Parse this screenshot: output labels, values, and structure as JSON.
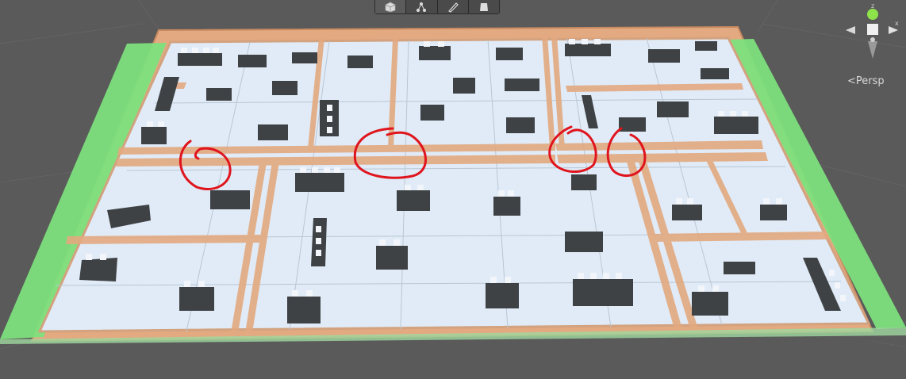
{
  "scene": {
    "projection_label": "Persp",
    "gizmo_axes": {
      "z": "z",
      "x": "x"
    }
  },
  "toolbar": {
    "tools": [
      {
        "name": "cube-icon"
      },
      {
        "name": "nodes-icon"
      },
      {
        "name": "pen-icon"
      },
      {
        "name": "sheet-icon"
      }
    ]
  },
  "colors": {
    "background": "#5a5a5a",
    "floor": "#e0ebf7",
    "wall": "#e3a980",
    "edge_green": "#7de07d",
    "desk": "#3f4245",
    "marker": "#e0141c"
  }
}
